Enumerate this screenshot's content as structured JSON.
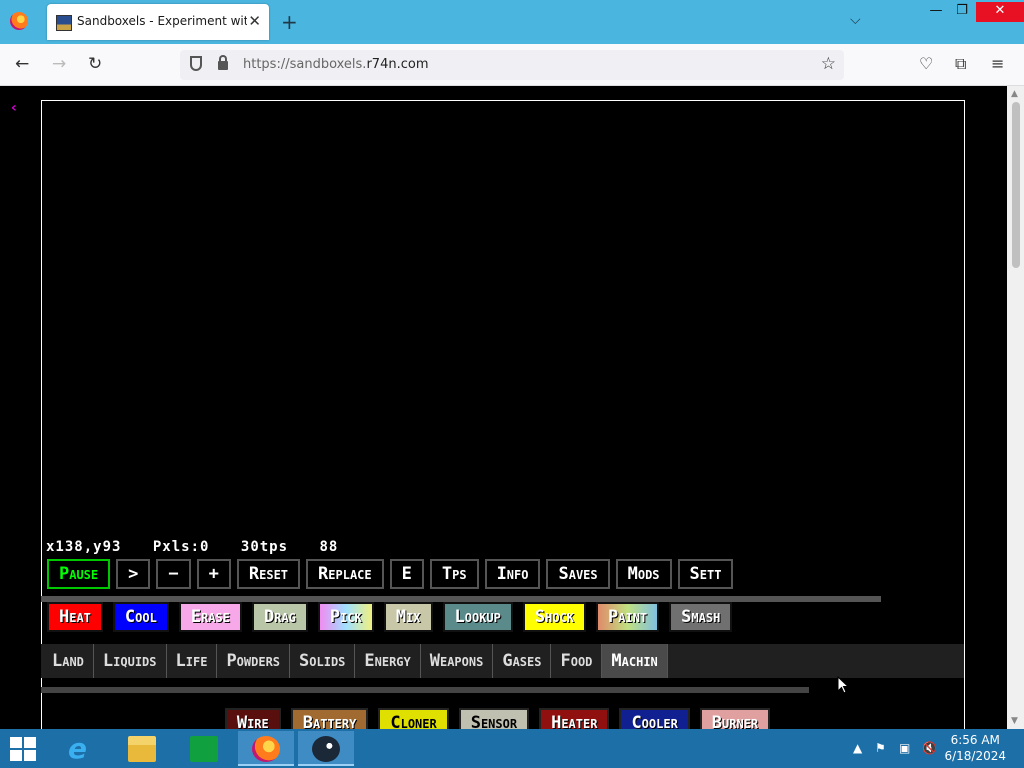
{
  "browser": {
    "tab_title": "Sandboxels - Experiment with P",
    "url_host_prefix": "https://sandboxels.",
    "url_host_main": "r74n.com"
  },
  "game": {
    "stats": {
      "coords": "x138,y93",
      "pixels": "Pxls:0",
      "tps": "30tps",
      "extra": "88"
    },
    "controls": [
      "Pause",
      ">",
      "−",
      "+",
      "Reset",
      "Replace",
      "E",
      "Tps",
      "Info",
      "Saves",
      "Mods",
      "Sett"
    ],
    "tools": [
      {
        "label": "Heat",
        "color": "#ff0000"
      },
      {
        "label": "Cool",
        "color": "#0000ff"
      },
      {
        "label": "Erase",
        "color": "#f7a8e8"
      },
      {
        "label": "Drag",
        "color": "#b9c7a8"
      },
      {
        "label": "Pick",
        "color": "#f0a0f0"
      },
      {
        "label": "Mix",
        "color": "#c0c0a0"
      },
      {
        "label": "Lookup",
        "color": "#5a8a8a"
      },
      {
        "label": "Shock",
        "color": "#ffff00"
      },
      {
        "label": "Paint",
        "color": "#e0a070"
      },
      {
        "label": "Smash",
        "color": "#707070"
      }
    ],
    "categories": [
      "Land",
      "Liquids",
      "Life",
      "Powders",
      "Solids",
      "Energy",
      "Weapons",
      "Gases",
      "Food",
      "Machin"
    ],
    "active_category": "Machin",
    "elements": [
      {
        "label": "Wire",
        "color": "#5a0f0f"
      },
      {
        "label": "Battery",
        "color": "#a06a30"
      },
      {
        "label": "Cloner",
        "color": "#e0e000"
      },
      {
        "label": "Sensor",
        "color": "#c0c0b0"
      },
      {
        "label": "Heater",
        "color": "#901010"
      },
      {
        "label": "Cooler",
        "color": "#102090"
      },
      {
        "label": "Burner",
        "color": "#e0a0a0"
      }
    ]
  },
  "taskbar": {
    "time": "6:56 AM",
    "date": "6/18/2024"
  }
}
